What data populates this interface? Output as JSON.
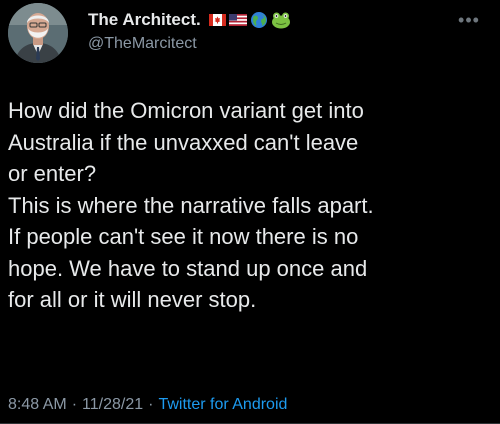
{
  "author": {
    "display_name": "The Architect.",
    "handle": "@TheMarcitect",
    "badges": [
      "canada-flag-icon",
      "us-flag-icon",
      "globe-icon",
      "frog-icon"
    ]
  },
  "tweet": {
    "lines": [
      "How did the Omicron variant get into",
      "Australia if the unvaxxed can't leave",
      "or enter?",
      "This is where the narrative falls apart.",
      "If people can't see it now there is no",
      "hope. We have to stand up once and",
      "for all or it will never stop."
    ]
  },
  "meta": {
    "time": "8:48 AM",
    "separator": "·",
    "date": "11/28/21",
    "source": "Twitter for Android"
  },
  "colors": {
    "background": "#000000",
    "text": "#e7e9ea",
    "secondary_text": "#8b98a5",
    "link": "#1d9bf0"
  }
}
